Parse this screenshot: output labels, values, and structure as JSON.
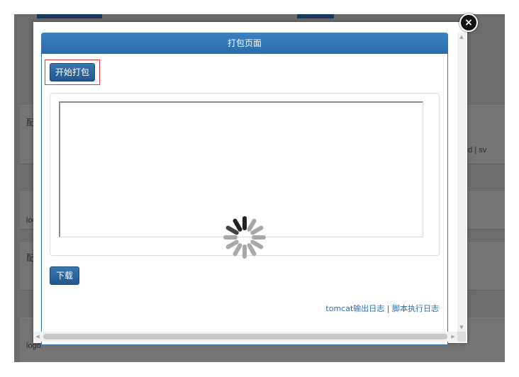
{
  "background_page": {
    "texts": [
      {
        "label": "配",
        "name": "bg-label-1"
      },
      {
        "label": "cloud  |  sv",
        "name": "bg-label-2"
      },
      {
        "label": "log",
        "name": "bg-label-3"
      },
      {
        "label": "配",
        "name": "bg-label-4"
      },
      {
        "label": "logo",
        "name": "bg-label-5"
      }
    ]
  },
  "modal": {
    "close_label": "×",
    "panel_title": "打包页面",
    "start_button": "开始打包",
    "download_button": "下载",
    "links": {
      "tomcat_log": "tomcat输出日志",
      "separator": "|",
      "script_log": "脚本执行日志"
    },
    "loading_icon": "spinner-icon"
  },
  "scrollbars": {
    "up_arrow": "▲",
    "down_arrow": "▼",
    "left_arrow": "◀",
    "right_arrow": "▶"
  },
  "colors": {
    "panel_header": "#2f72b3",
    "button": "#2c66a0",
    "highlight": "#e0393e",
    "link": "#2a6db3",
    "overlay": "#6d6d6d"
  }
}
